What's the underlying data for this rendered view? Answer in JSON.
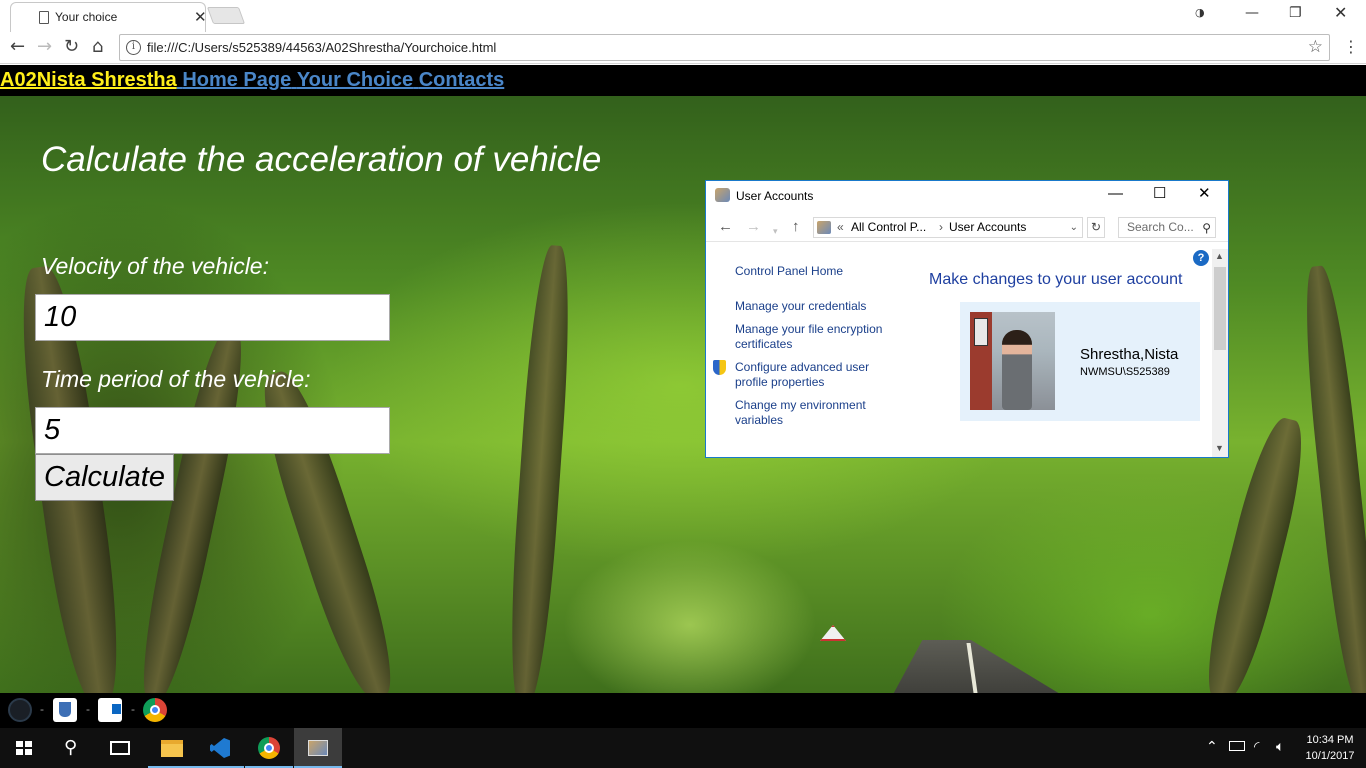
{
  "browser": {
    "tab_title": "Your choice",
    "url": "file:///C:/Users/s525389/44563/A02Shrestha/Yourchoice.html"
  },
  "site": {
    "brand": "A02Nista  Shrestha",
    "nav": [
      "Home Page",
      "Your Choice",
      "Contacts"
    ],
    "heading": "Calculate the acceleration of vehicle",
    "velocity_label": "Velocity of the vehicle:",
    "velocity_value": "10",
    "time_label": "Time period of the vehicle:",
    "time_value": "5",
    "calculate_label": "Calculate"
  },
  "user_accounts": {
    "title": "User Accounts",
    "breadcrumb": [
      "All Control P...",
      "User Accounts"
    ],
    "search_placeholder": "Search Co...",
    "side_links": [
      "Control Panel Home",
      "Manage your credentials",
      "Manage your file encryption certificates",
      "Configure advanced user profile properties",
      "Change my environment variables"
    ],
    "heading": "Make changes to your user account",
    "user_name": "Shrestha,Nista",
    "user_id": "NWMSU\\S525389"
  },
  "bookmark_separators": [
    "-",
    "-",
    "-"
  ],
  "taskbar": {
    "time": "10:34 PM",
    "date": "10/1/2017"
  },
  "icons": {
    "accent": "#76b9ed",
    "brand_color": "#ffef1a",
    "link_color": "#4a86c8"
  }
}
